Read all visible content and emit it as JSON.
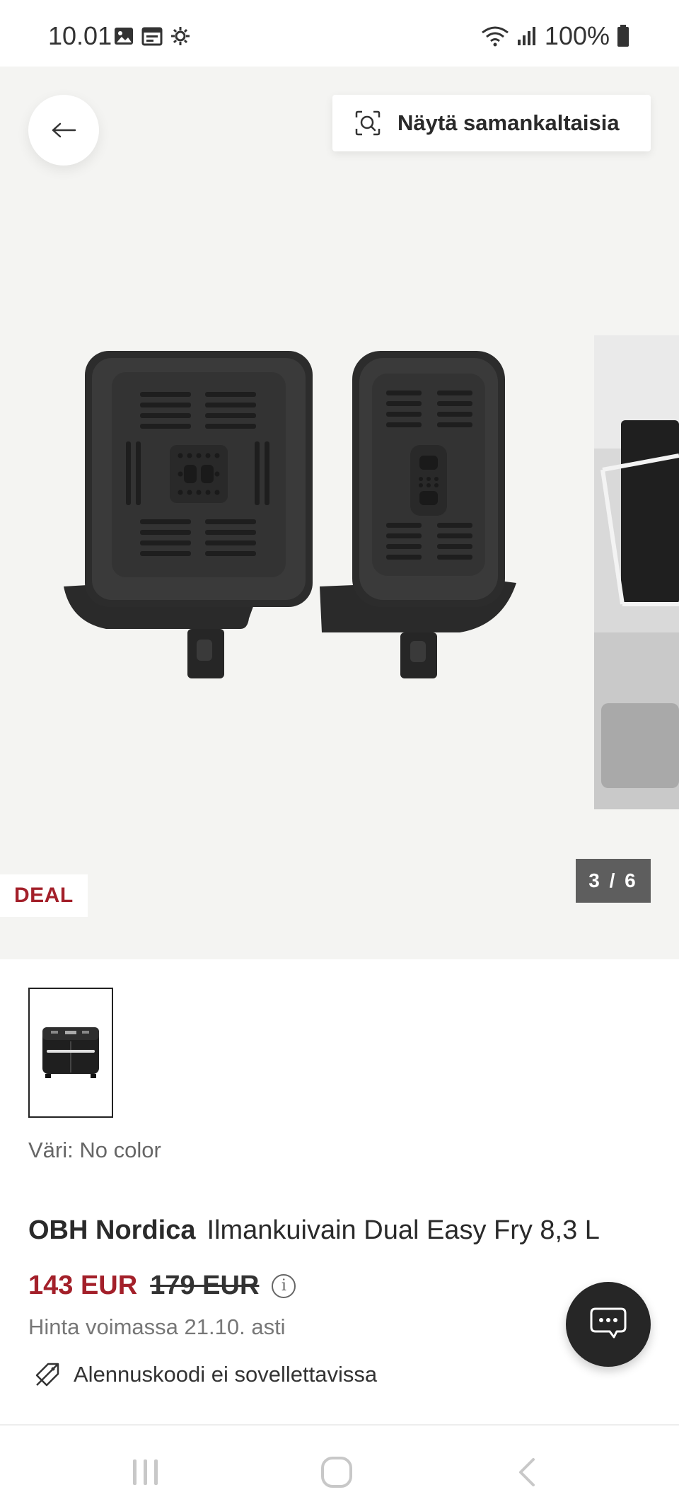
{
  "status_bar": {
    "time": "10.01",
    "battery": "100%",
    "icons": [
      "image-icon",
      "calendar-icon",
      "settings-icon",
      "wifi-icon",
      "signal-icon",
      "battery-icon"
    ]
  },
  "gallery": {
    "similar_button_label": "Näytä samankaltaisia",
    "deal_badge": "DEAL",
    "page_counter": "3 / 6"
  },
  "product": {
    "color_label": "Väri: No color",
    "brand": "OBH Nordica",
    "name": "Ilmankuivain Dual Easy Fry 8,3 L",
    "price_current": "143 EUR",
    "price_original": "179 EUR",
    "price_valid": "Hinta voimassa 21.10. asti",
    "discount_note": "Alennuskoodi ei sovellettavissa"
  },
  "colors": {
    "accent_red": "#a3202a",
    "gallery_bg": "#f4f4f2",
    "counter_bg": "#5e5e5e",
    "chat_bg": "#262626"
  }
}
